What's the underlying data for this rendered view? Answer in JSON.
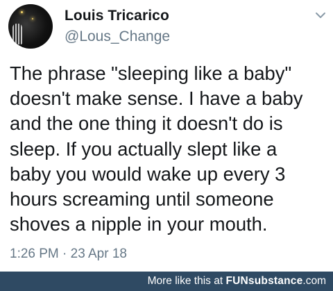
{
  "tweet": {
    "display_name": "Louis Tricarico",
    "handle": "@Lous_Change",
    "text": "The phrase \"sleeping like a baby\"\ndoesn't make sense.  I have a baby\nand the one thing it doesn't do is\nsleep.  If you actually slept like a\nbaby you would wake up every 3\nhours screaming until someone\nshoves a nipple in your mouth.",
    "timestamp": "1:26 PM · 23 Apr 18",
    "avatar_icon": "profile-photo",
    "menu_icon": "chevron-down-icon"
  },
  "footer": {
    "prefix": "More like this at ",
    "brand_main": "FUNsubstance",
    "brand_suffix": ".com",
    "background_color": "#2f4a63"
  }
}
